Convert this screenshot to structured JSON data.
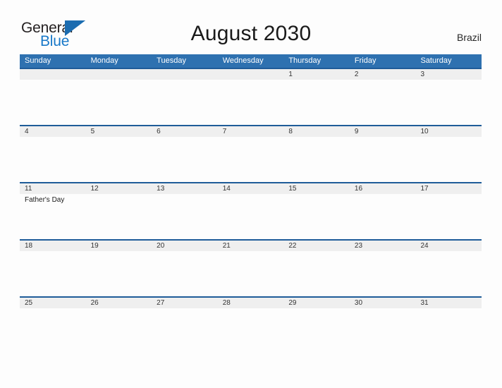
{
  "logo": {
    "word_one": "General",
    "word_two": "Blue",
    "triangle_icon": "triangle-flag-icon",
    "dark_color": "#231f20",
    "blue_color": "#1878c8"
  },
  "header": {
    "title": "August 2030",
    "country": "Brazil"
  },
  "colors": {
    "header_blue": "#2e71b0",
    "row_divider_blue": "#1f5c99",
    "date_strip_gray": "#efefef",
    "page_background": "#fdfdfd"
  },
  "calendar": {
    "weekday_headers": [
      "Sunday",
      "Monday",
      "Tuesday",
      "Wednesday",
      "Thursday",
      "Friday",
      "Saturday"
    ],
    "weeks": [
      {
        "dates": [
          "",
          "",
          "",
          "",
          "1",
          "2",
          "3"
        ],
        "events": [
          "",
          "",
          "",
          "",
          "",
          "",
          ""
        ]
      },
      {
        "dates": [
          "4",
          "5",
          "6",
          "7",
          "8",
          "9",
          "10"
        ],
        "events": [
          "",
          "",
          "",
          "",
          "",
          "",
          ""
        ]
      },
      {
        "dates": [
          "11",
          "12",
          "13",
          "14",
          "15",
          "16",
          "17"
        ],
        "events": [
          "Father's Day",
          "",
          "",
          "",
          "",
          "",
          ""
        ]
      },
      {
        "dates": [
          "18",
          "19",
          "20",
          "21",
          "22",
          "23",
          "24"
        ],
        "events": [
          "",
          "",
          "",
          "",
          "",
          "",
          ""
        ]
      },
      {
        "dates": [
          "25",
          "26",
          "27",
          "28",
          "29",
          "30",
          "31"
        ],
        "events": [
          "",
          "",
          "",
          "",
          "",
          "",
          ""
        ]
      }
    ]
  }
}
